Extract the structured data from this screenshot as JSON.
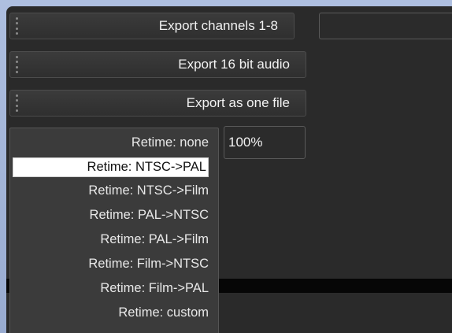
{
  "buttons": {
    "export_channels": "Export channels 1-8",
    "export_16bit": "Export 16 bit audio",
    "export_one_file": "Export as one file"
  },
  "percent_field": {
    "value": "100%"
  },
  "top_right_field": {
    "value": ""
  },
  "retime_menu": {
    "items": [
      "Retime: none",
      "Retime: NTSC->PAL",
      "Retime: NTSC->Film",
      "Retime: PAL->NTSC",
      "Retime: PAL->Film",
      "Retime: Film->NTSC",
      "Retime: Film->PAL",
      "Retime: custom"
    ],
    "highlighted": "Retime: NTSC->PAL"
  }
}
